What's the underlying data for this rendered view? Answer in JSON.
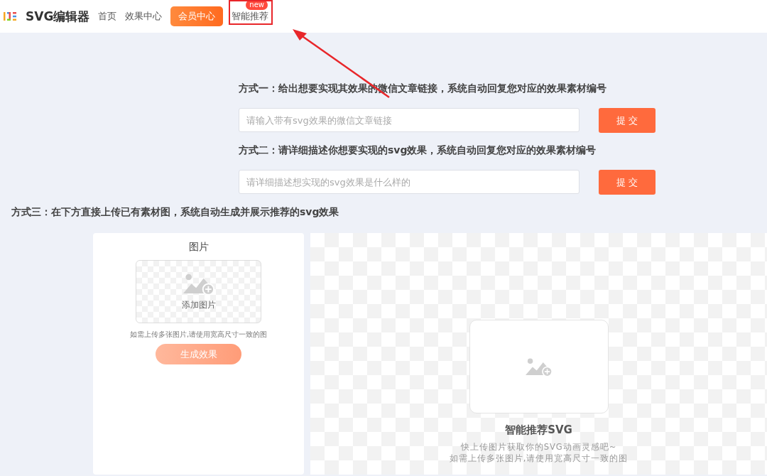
{
  "header": {
    "brand": "SVG编辑器",
    "nav": [
      {
        "label": "首页",
        "kind": "link"
      },
      {
        "label": "效果中心",
        "kind": "link"
      },
      {
        "label": "会员中心",
        "kind": "button"
      },
      {
        "label": "智能推荐",
        "kind": "link",
        "badge": "new",
        "highlighted": true
      }
    ]
  },
  "methods": [
    {
      "title": "方式一：给出想要实现其效果的微信文章链接，系统自动回复您对应的效果素材编号",
      "placeholder": "请输入带有svg效果的微信文章链接",
      "button": "提 交"
    },
    {
      "title": "方式二：请详细描述你想要实现的svg效果，系统自动回复您对应的效果素材编号",
      "placeholder": "请详细描述想实现的svg效果是什么样的",
      "button": "提 交"
    }
  ],
  "method3": {
    "title": "方式三：在下方直接上传已有素材图，系统自动生成并展示推荐的svg效果"
  },
  "upload_card": {
    "title": "图片",
    "add_label": "添加图片",
    "hint": "如需上传多张图片,请使用宽高尺寸一致的图",
    "button": "生成效果",
    "disabled": true
  },
  "preview": {
    "title": "智能推荐SVG",
    "lines": [
      "快上传图片获取你的SVG动画灵感吧~",
      "如需上传多张图片,请使用宽高尺寸一致的图"
    ]
  }
}
